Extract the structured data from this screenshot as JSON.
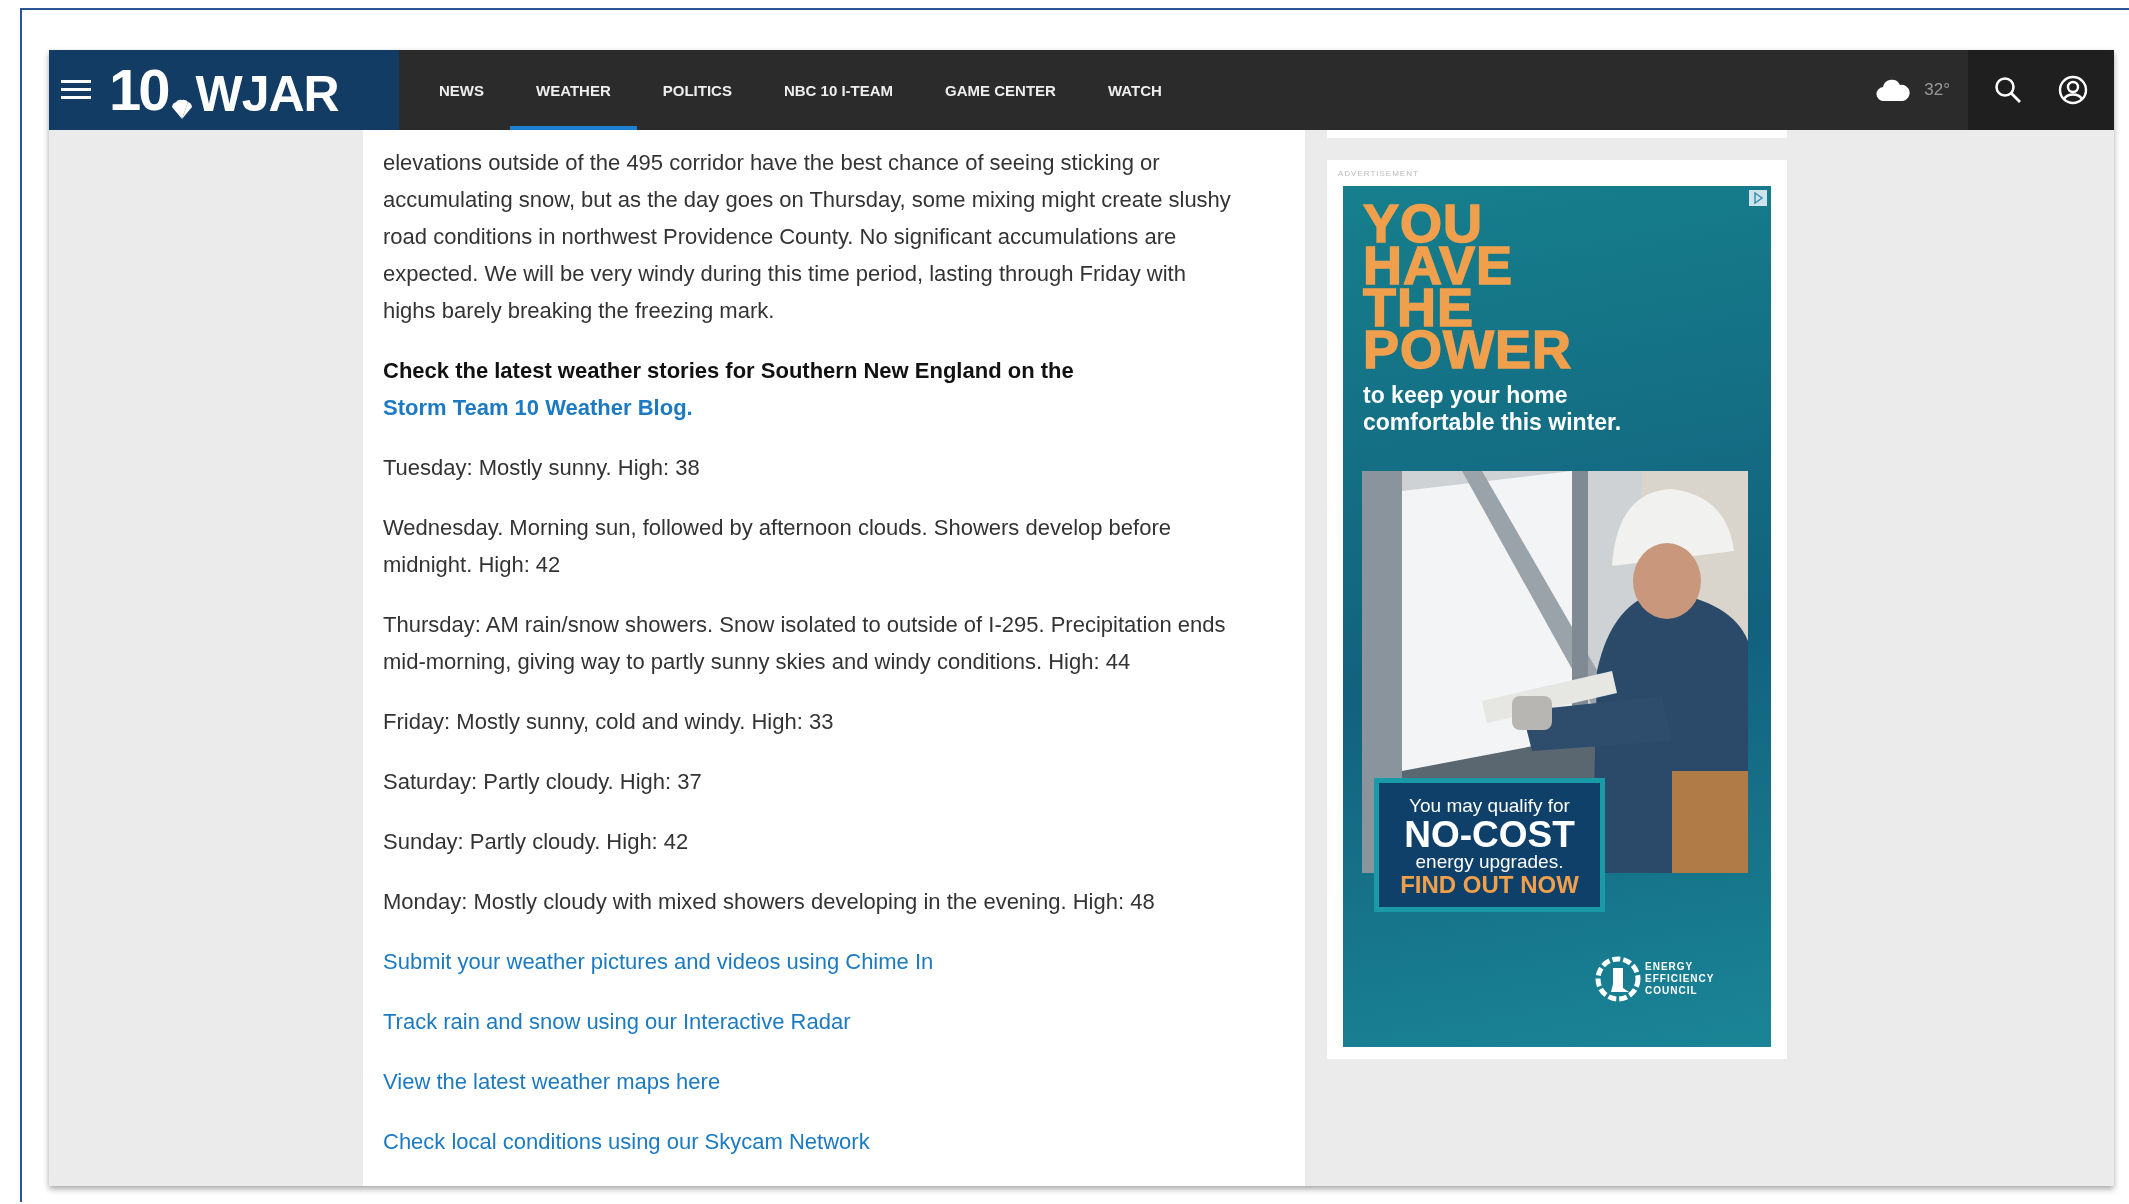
{
  "header": {
    "logo": {
      "number": "10",
      "name": "WJAR"
    },
    "nav": [
      {
        "label": "NEWS",
        "selected": false
      },
      {
        "label": "WEATHER",
        "selected": true
      },
      {
        "label": "POLITICS",
        "selected": false
      },
      {
        "label": "NBC 10 I-TEAM",
        "selected": false
      },
      {
        "label": "GAME CENTER",
        "selected": false
      },
      {
        "label": "WATCH",
        "selected": false
      }
    ],
    "temperature": "32°"
  },
  "article": {
    "paragraphs": [
      {
        "kind": "text",
        "text": "elevations outside of the 495 corridor have the best chance of seeing sticking or accumulating snow, but as the day goes on Thursday, some mixing might create slushy road conditions in northwest Providence County. No significant accumulations are expected. We will be very windy during this time period, lasting through Friday with highs barely breaking the freezing mark."
      },
      {
        "kind": "callout",
        "text": "Check the latest weather stories for Southern New England on the ",
        "link": "Storm Team 10 Weather Blog."
      },
      {
        "kind": "text",
        "text": "Tuesday: Mostly sunny. High: 38"
      },
      {
        "kind": "text",
        "text": "Wednesday. Morning sun, followed by afternoon clouds. Showers develop before midnight. High: 42"
      },
      {
        "kind": "text",
        "text": "Thursday: AM rain/snow showers. Snow isolated to outside of I-295. Precipitation ends mid-morning, giving way to partly sunny skies and windy conditions. High: 44"
      },
      {
        "kind": "text",
        "text": "Friday: Mostly sunny, cold and windy. High: 33"
      },
      {
        "kind": "text",
        "text": "Saturday: Partly cloudy. High: 37"
      },
      {
        "kind": "text",
        "text": "Sunday: Partly cloudy. High: 42"
      },
      {
        "kind": "text",
        "text": "Monday: Mostly cloudy with mixed showers developing in the evening. High: 48"
      },
      {
        "kind": "link",
        "text": "Submit your weather pictures and videos using Chime In"
      },
      {
        "kind": "link",
        "text": "Track rain and snow using our Interactive Radar"
      },
      {
        "kind": "link",
        "text": "View the latest weather maps here"
      },
      {
        "kind": "link",
        "text": "Check local conditions using our Skycam Network"
      }
    ]
  },
  "ad": {
    "label": "ADVERTISEMENT",
    "headline": [
      "YOU",
      "HAVE",
      "THE",
      "POWER"
    ],
    "subhead": "to keep your home comfortable this winter.",
    "offer": {
      "intro": "You may qualify for",
      "main": "NO-COST",
      "detail": "energy upgrades.",
      "cta": "FIND OUT NOW"
    },
    "sponsor": [
      "ENERGY",
      "EFFICIENCY",
      "COUNCIL"
    ]
  }
}
